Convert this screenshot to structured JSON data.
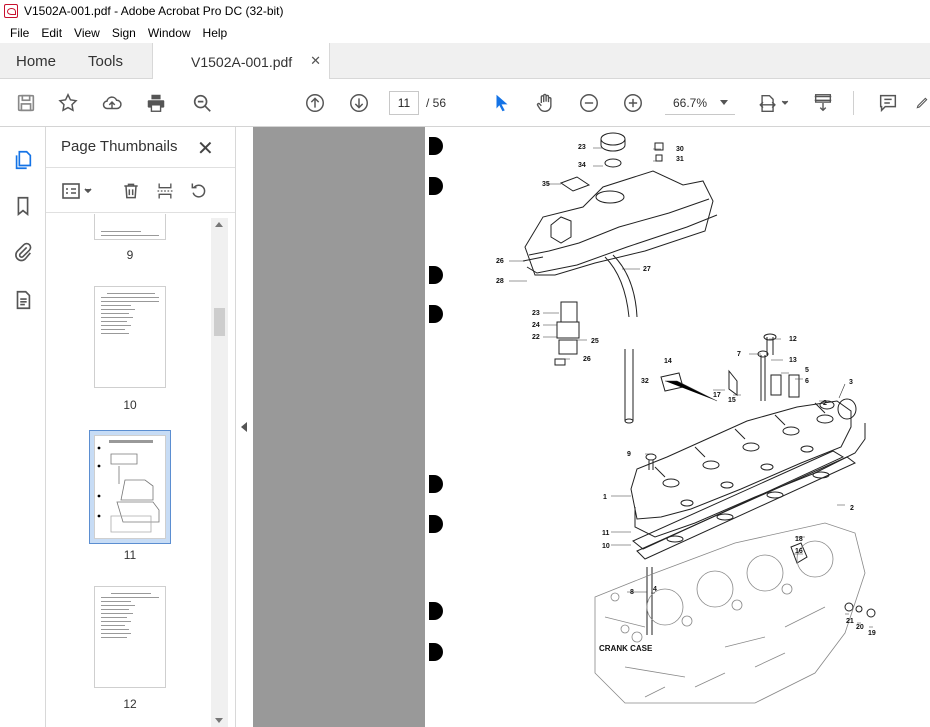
{
  "window": {
    "title": "V1502A-001.pdf - Adobe Acrobat Pro DC (32-bit)"
  },
  "menu": [
    "File",
    "Edit",
    "View",
    "Sign",
    "Window",
    "Help"
  ],
  "tabs": {
    "home": "Home",
    "tools": "Tools",
    "document": "V1502A-001.pdf",
    "close_glyph": "✕"
  },
  "toolbar": {
    "current_page": "11",
    "total_pages": "/ 56",
    "zoom": "66.7%"
  },
  "panel": {
    "title": "Page Thumbnails",
    "close_glyph": "✕",
    "thumbnails": [
      {
        "label": "9"
      },
      {
        "label": "10"
      },
      {
        "label": "11",
        "selected": true
      },
      {
        "label": "12"
      }
    ]
  },
  "drawing": {
    "part_numbers": [
      "23",
      "30",
      "31",
      "34",
      "35",
      "26",
      "28",
      "27",
      "23",
      "24",
      "22",
      "25",
      "26",
      "14",
      "32",
      "12",
      "7",
      "13",
      "5",
      "6",
      "3",
      "17",
      "15",
      "2",
      "9",
      "1",
      "11",
      "10",
      "18",
      "16",
      "8",
      "4",
      "21",
      "20",
      "19",
      "2"
    ],
    "crank_case_label": "CRANK CASE"
  },
  "colors": {
    "accent": "#1473e6",
    "selection": "#c7dcf5",
    "doc_bg": "#999999"
  }
}
